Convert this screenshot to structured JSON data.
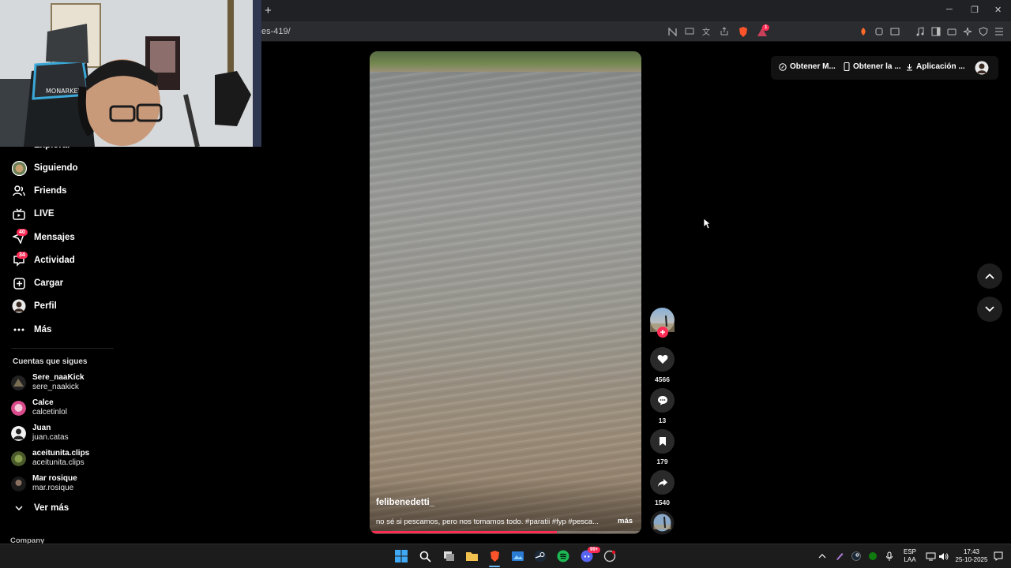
{
  "browser": {
    "url_fragment": "es-419/",
    "newtab_label": "+",
    "window_minimize": "─",
    "window_restore": "❐",
    "window_close": "✕",
    "brave_badge": "1"
  },
  "top_actions": {
    "get_more": "Obtener M...",
    "get_app": "Obtener la ...",
    "download_app": "Aplicación ..."
  },
  "sidebar": {
    "nav": [
      {
        "label": "Explorar"
      },
      {
        "label": "Siguiendo"
      },
      {
        "label": "Friends"
      },
      {
        "label": "LIVE"
      },
      {
        "label": "Mensajes",
        "badge": "40"
      },
      {
        "label": "Actividad",
        "badge": "34"
      },
      {
        "label": "Cargar"
      },
      {
        "label": "Perfil"
      },
      {
        "label": "Más"
      }
    ],
    "following_title": "Cuentas que sigues",
    "following": [
      {
        "name": "Sere_naaKick",
        "handle": "sere_naakick"
      },
      {
        "name": "Calce",
        "handle": "calcetinlol"
      },
      {
        "name": "Juan",
        "handle": "juan.catas"
      },
      {
        "name": "aceitunita.clips",
        "handle": "aceitunita.clips"
      },
      {
        "name": "Mar rosique",
        "handle": "mar.rosique"
      }
    ],
    "see_more": "Ver más",
    "footer_company": "Company"
  },
  "video": {
    "author": "felibenedetti_",
    "description": "no sé si pescamos, pero nos tomamos todo.  #paratii #fyp #pesca...",
    "more": "más",
    "progress": 0.69
  },
  "actions": {
    "likes": "4566",
    "comments": "13",
    "saves": "179",
    "shares": "1540"
  },
  "taskbar": {
    "lang_top": "ESP",
    "lang_bottom": "LAA",
    "time": "17:43",
    "date": "25-10-2025",
    "notif_badge": "99+"
  },
  "colors": {
    "accent": "#fe2c55",
    "background": "#000000"
  }
}
